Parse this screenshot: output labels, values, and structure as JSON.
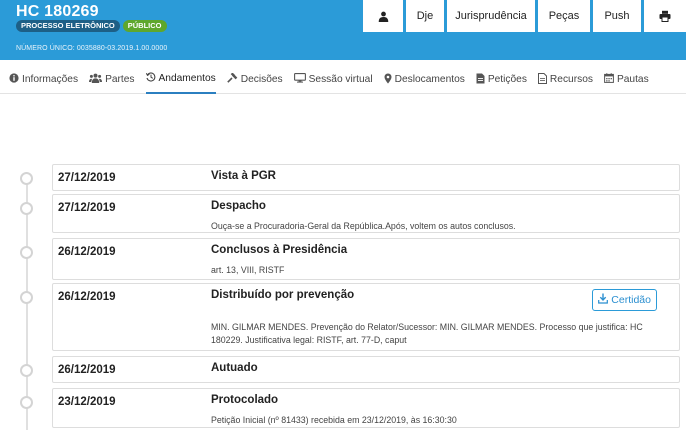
{
  "header": {
    "case_title": "HC 180269",
    "badge_electronic": "PROCESSO ELETRÔNICO",
    "badge_public": "PÚBLICO",
    "numero_unico": "NÚMERO ÚNICO: 0035880-03.2019.1.00.0000"
  },
  "topnav": {
    "user_icon": "user-icon",
    "dje": "Dje",
    "jurisprudencia": "Jurisprudência",
    "pecas": "Peças",
    "push": "Push",
    "print_icon": "printer-icon"
  },
  "tabs": [
    {
      "label": "Informações",
      "icon": "info-icon"
    },
    {
      "label": "Partes",
      "icon": "users-icon"
    },
    {
      "label": "Andamentos",
      "icon": "history-icon"
    },
    {
      "label": "Decisões",
      "icon": "gavel-icon"
    },
    {
      "label": "Sessão virtual",
      "icon": "monitor-icon"
    },
    {
      "label": "Deslocamentos",
      "icon": "map-marker-icon"
    },
    {
      "label": "Petições",
      "icon": "document-icon"
    },
    {
      "label": "Recursos",
      "icon": "file-icon"
    },
    {
      "label": "Pautas",
      "icon": "calendar-icon"
    }
  ],
  "active_tab": "Andamentos",
  "entries": [
    {
      "date": "27/12/2019",
      "title": "Vista à PGR",
      "description": ""
    },
    {
      "date": "27/12/2019",
      "title": "Despacho",
      "description": "Ouça-se a Procuradoria-Geral da República.Após, voltem os autos conclusos."
    },
    {
      "date": "26/12/2019",
      "title": "Conclusos à Presidência",
      "description": "art. 13, VIII, RISTF"
    },
    {
      "date": "26/12/2019",
      "title": "Distribuído por prevenção",
      "description": "MIN. GILMAR MENDES. Prevenção do Relator/Sucessor: MIN. GILMAR MENDES. Processo que justifica: HC 180229. Justificativa legal: RISTF, art. 77-D, caput",
      "button": "Certidão"
    },
    {
      "date": "26/12/2019",
      "title": "Autuado",
      "description": ""
    },
    {
      "date": "23/12/2019",
      "title": "Protocolado",
      "description": "Petição Inicial (nº 81433) recebida em 23/12/2019, às 16:30:30"
    }
  ],
  "colors": {
    "header_blue": "#2b9bd8",
    "badge_dark": "#1d5f86",
    "badge_green": "#5ea72c",
    "active_tab_underline": "#2b7fc0"
  }
}
